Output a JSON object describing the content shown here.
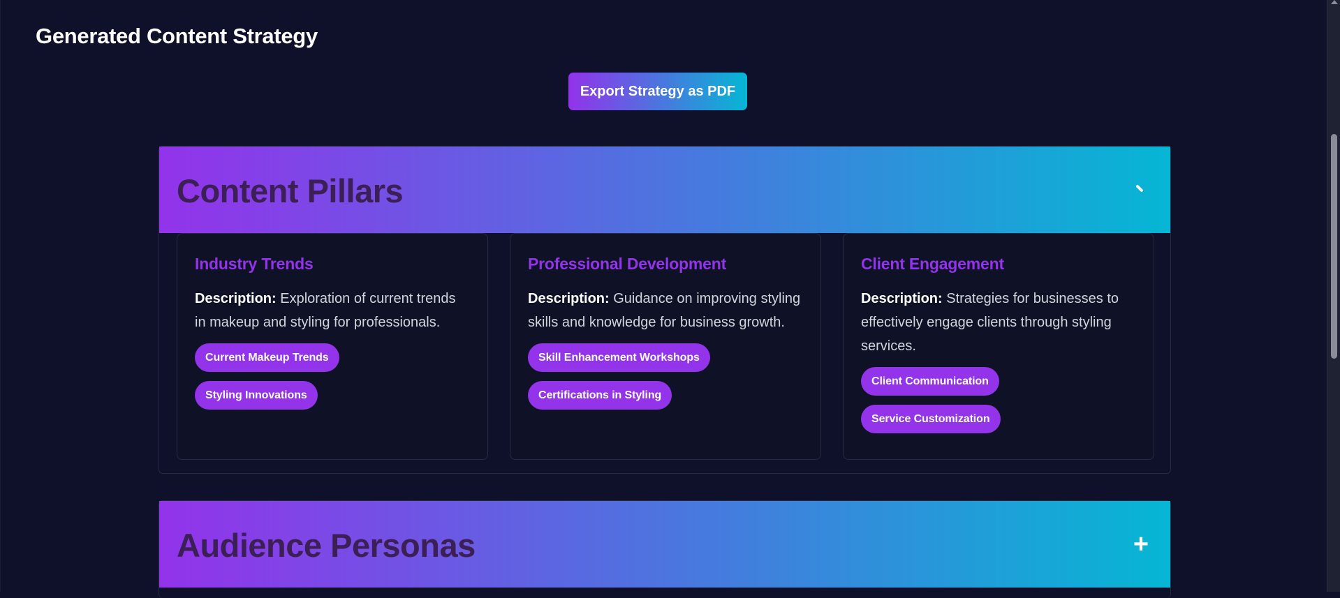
{
  "page": {
    "title": "Generated Content Strategy"
  },
  "toolbar": {
    "export_label": "Export Strategy as PDF"
  },
  "sections": [
    {
      "title": "Content Pillars",
      "expanded": true,
      "toggle_icon": "collapse-icon",
      "pillars": [
        {
          "name": "Industry Trends",
          "desc_label": "Description:",
          "desc_text": " Exploration of current trends in makeup and styling for professionals.",
          "tags": [
            "Current Makeup Trends",
            "Styling Innovations"
          ]
        },
        {
          "name": "Professional Development",
          "desc_label": "Description:",
          "desc_text": " Guidance on improving styling skills and knowledge for business growth.",
          "tags": [
            "Skill Enhancement Workshops",
            "Certifications in Styling"
          ]
        },
        {
          "name": "Client Engagement",
          "desc_label": "Description:",
          "desc_text": " Strategies for businesses to effectively engage clients through styling services.",
          "tags": [
            "Client Communication",
            "Service Customization"
          ]
        }
      ]
    },
    {
      "title": "Audience Personas",
      "expanded": false,
      "toggle_icon": "plus-icon",
      "toggle_glyph": "+"
    }
  ],
  "colors": {
    "background": "#0e1129",
    "accent_purple": "#9333ea",
    "accent_cyan": "#06b6d4",
    "header_title": "#3b1f55"
  }
}
